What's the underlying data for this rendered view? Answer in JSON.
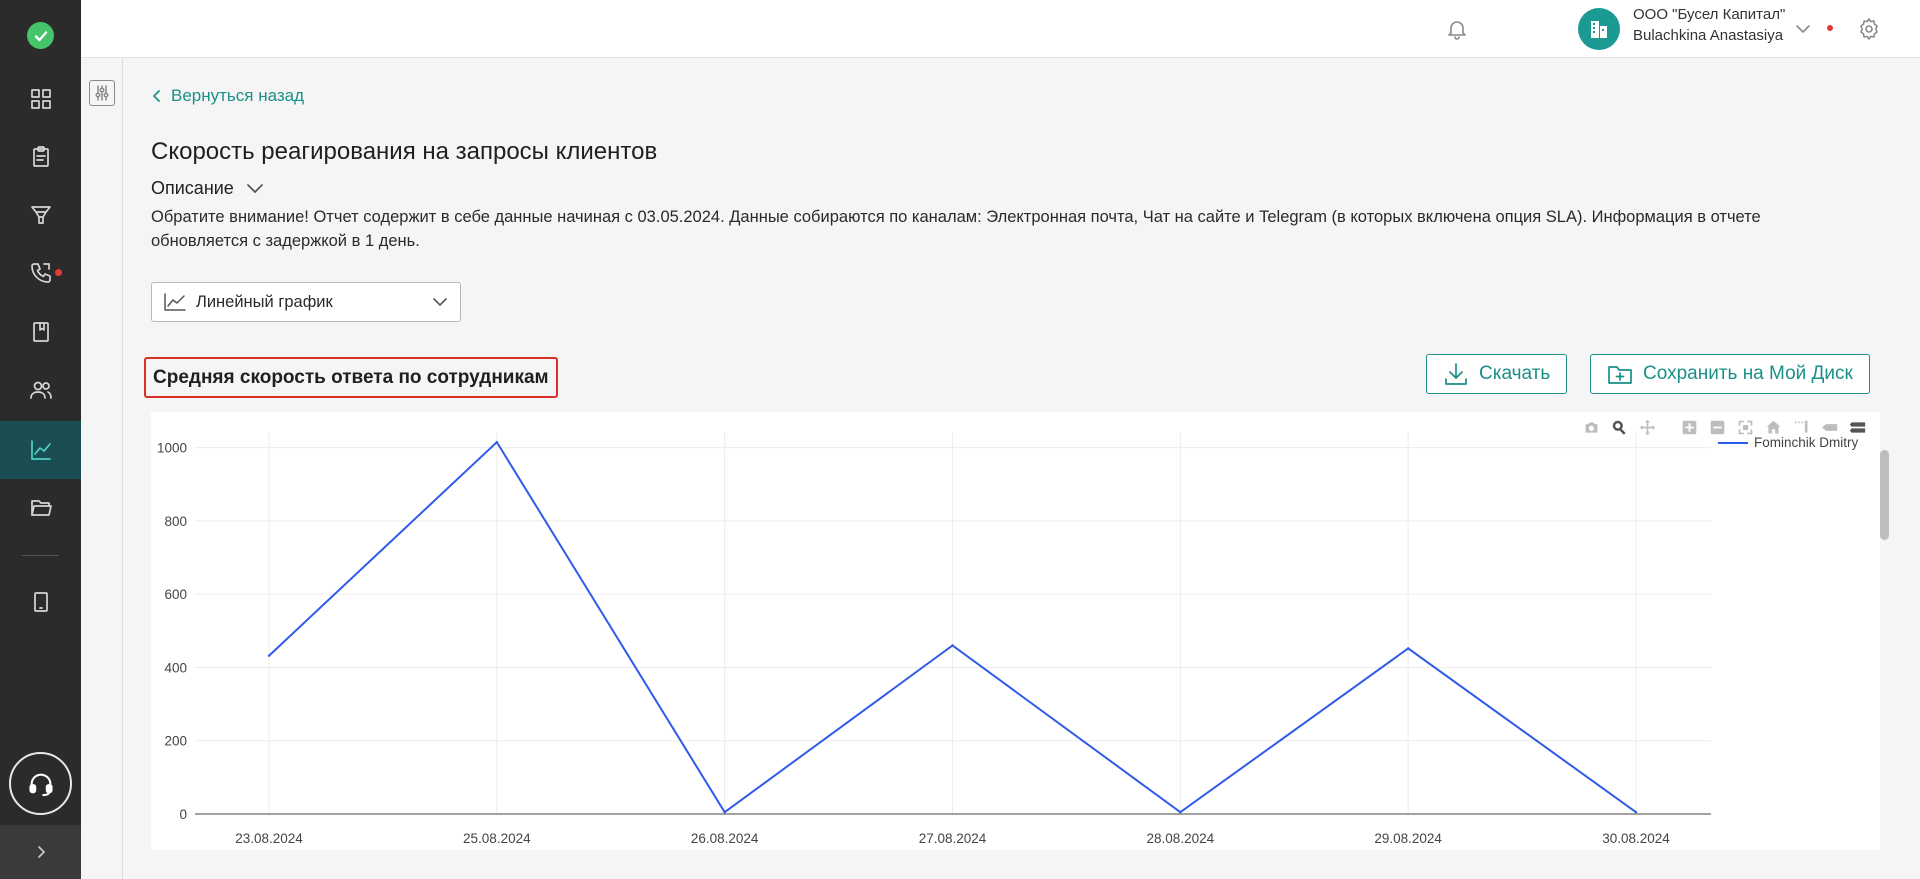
{
  "topbar": {
    "org_name": "ООО \"Бусел Капитал\"",
    "user_name": "Bulachkina Anastasiya"
  },
  "back_link": {
    "label": "Вернуться назад"
  },
  "page_title": "Скорость реагирования на запросы клиентов",
  "description": {
    "toggle_label": "Описание",
    "text": "Обратите внимание! Отчет содержит в себе данные начиная с 03.05.2024. Данные собираются по каналам: Электронная почта, Чат на сайте и Telegram (в которых включена опция SLA). Информация в отчете обновляется с задержкой в 1 день."
  },
  "chart_type_select": {
    "value": "Линейный график"
  },
  "section_title": "Средняя скорость ответа по сотрудникам",
  "actions": {
    "download_label": "Скачать",
    "save_label": "Сохранить на Мой Диск"
  },
  "colors": {
    "accent": "#1a8f88",
    "sidebar_bg": "#2b2b2b",
    "sidebar_active": "#1a4e52",
    "series_line": "#2f5bea",
    "highlight_border": "#d93025"
  },
  "chart_data": {
    "type": "line",
    "x": [
      "23.08.2024",
      "25.08.2024",
      "26.08.2024",
      "27.08.2024",
      "28.08.2024",
      "29.08.2024",
      "30.08.2024"
    ],
    "series": [
      {
        "name": "Fominchik Dmitry",
        "values": [
          432,
          1015,
          5,
          460,
          5,
          452,
          5
        ]
      }
    ],
    "yticks": [
      "0",
      "200",
      "400",
      "600",
      "800",
      "1000"
    ],
    "ylim": [
      0,
      1070
    ],
    "grid": true,
    "legend": "top-right"
  }
}
